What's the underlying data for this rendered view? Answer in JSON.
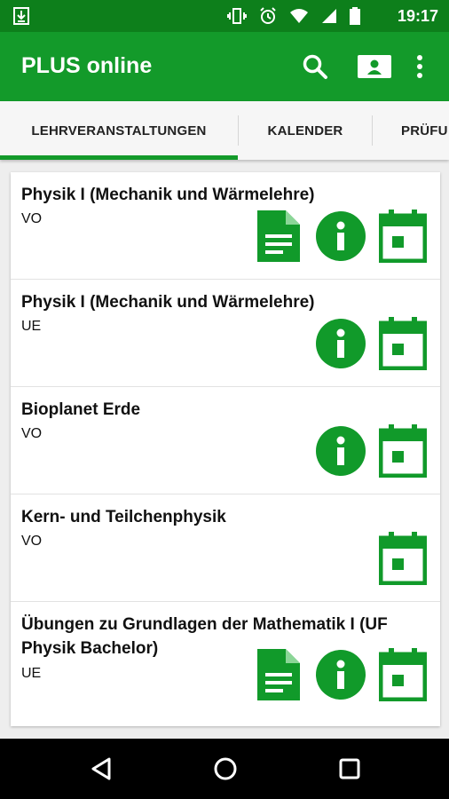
{
  "status": {
    "time": "19:17"
  },
  "app": {
    "title": "PLUS online"
  },
  "tabs": [
    {
      "label": "LEHRVERANSTALTUNGEN",
      "active": true
    },
    {
      "label": "KALENDER",
      "active": false
    },
    {
      "label": "PRÜFU",
      "active": false
    }
  ],
  "courses": [
    {
      "name": "Physik I (Mechanik und Wärmelehre)",
      "type": "VO",
      "actions": [
        "document-icon",
        "info-icon",
        "calendar-icon"
      ]
    },
    {
      "name": "Physik I (Mechanik und Wärmelehre)",
      "type": "UE",
      "actions": [
        "info-icon",
        "calendar-icon"
      ]
    },
    {
      "name": "Bioplanet Erde",
      "type": "VO",
      "actions": [
        "info-icon",
        "calendar-icon"
      ]
    },
    {
      "name": "Kern- und Teilchenphysik",
      "type": "VO",
      "actions": [
        "calendar-icon"
      ]
    },
    {
      "name": "Übungen zu Grundlagen der Mathematik I (UF Physik Bachelor)",
      "type": "UE",
      "actions": [
        "document-icon",
        "info-icon",
        "calendar-icon"
      ]
    }
  ],
  "colors": {
    "primary": "#139a2a",
    "primary_dark": "#0d7f1b",
    "accent": "#119a2a"
  }
}
